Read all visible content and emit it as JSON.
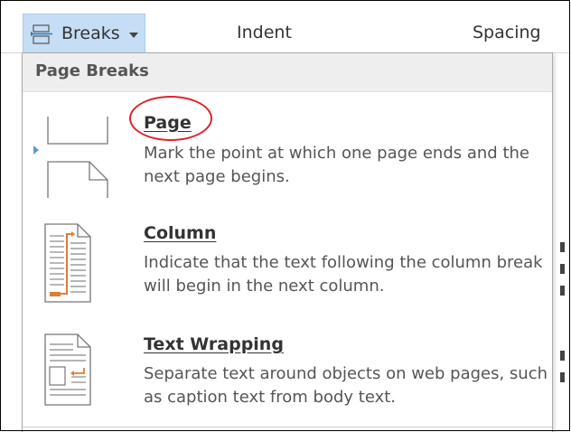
{
  "ribbon": {
    "breaks_label": "Breaks",
    "indent_label": "Indent",
    "spacing_label": "Spacing"
  },
  "menu": {
    "section_header": "Page Breaks",
    "items": [
      {
        "title": "Page",
        "description": "Mark the point at which one page ends and the next page begins.",
        "icon": "page-break-icon"
      },
      {
        "title": "Column",
        "description": "Indicate that the text following the column break will begin in the next column.",
        "icon": "column-break-icon"
      },
      {
        "title": "Text Wrapping",
        "description": "Separate text around objects on web pages, such as caption text from body text.",
        "icon": "text-wrapping-break-icon"
      }
    ]
  },
  "colors": {
    "active_button": "#c5def5",
    "annotation": "#e0242b",
    "accent_orange": "#e07b39"
  }
}
